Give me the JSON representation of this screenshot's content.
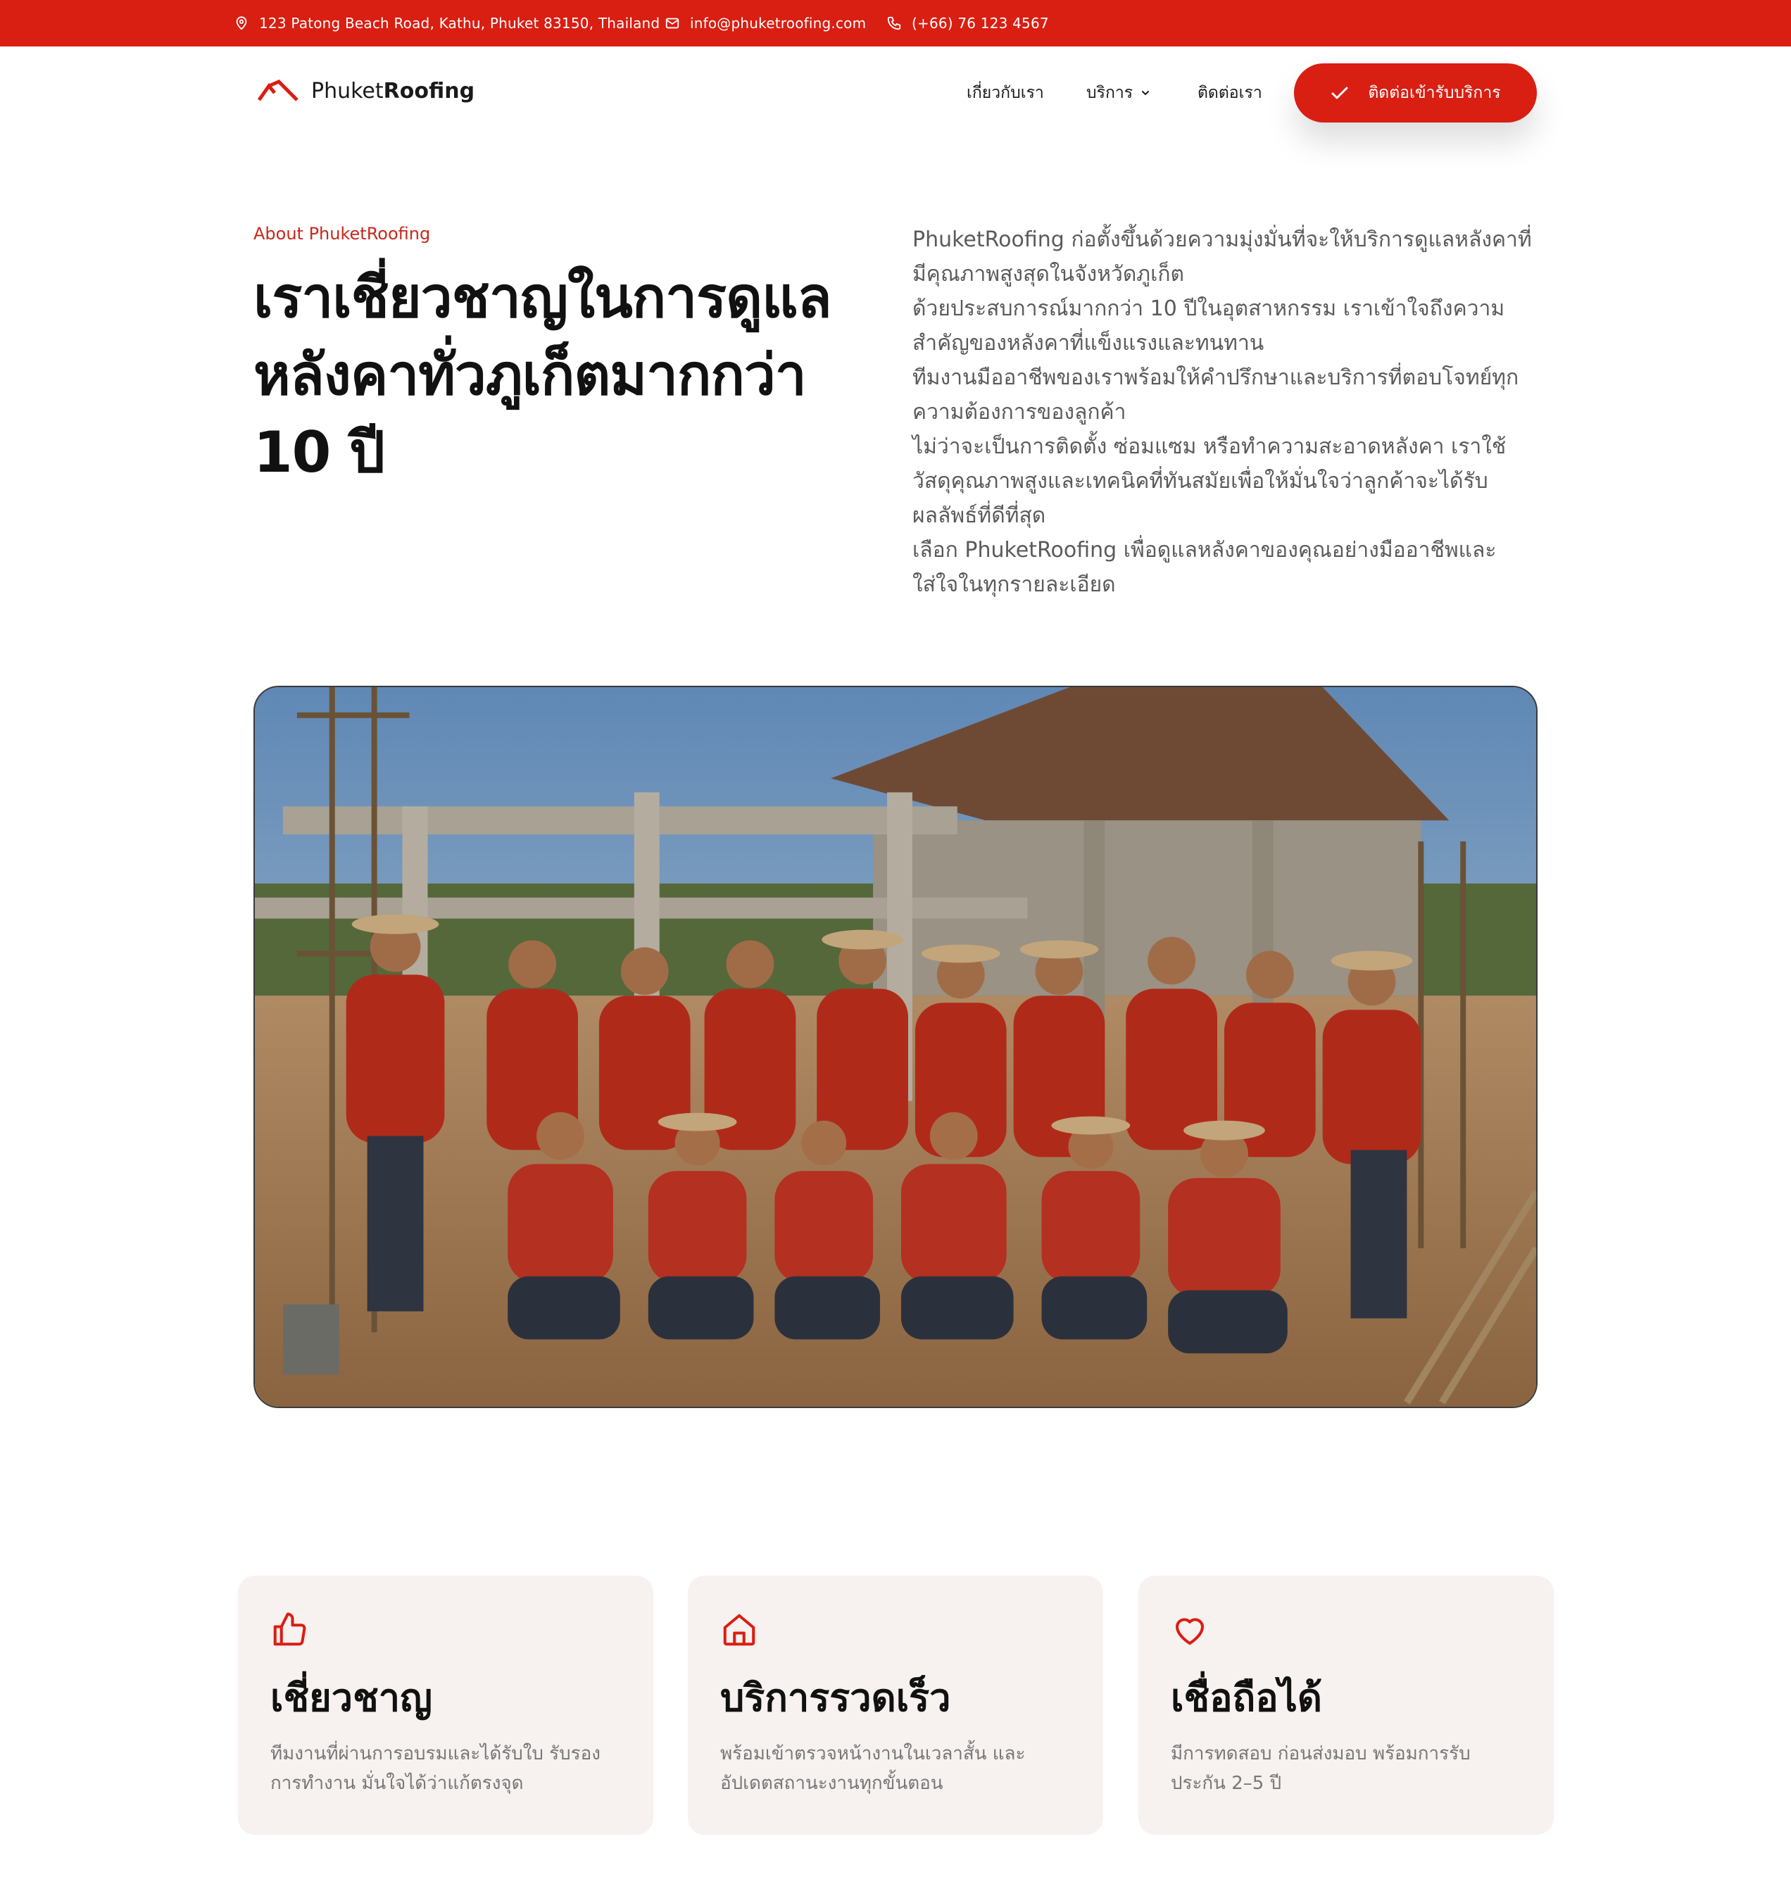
{
  "topbar": {
    "address": "123 Patong Beach Road, Kathu, Phuket 83150, Thailand",
    "email": "info@phuketroofing.com",
    "phone": "(+66) 76 123 4567",
    "address_icon": "map-pin-icon",
    "email_icon": "envelope-icon",
    "phone_icon": "phone-icon"
  },
  "header": {
    "brand_light": "Phuket",
    "brand_bold": "Roofing",
    "logo_icon": "roof-logo-icon",
    "nav": {
      "about": "เกี่ยวกับเรา",
      "services": "บริการ",
      "contact": "ติดต่อเรา"
    },
    "cta_label": "ติดต่อเข้ารับบริการ",
    "cta_icon": "check-icon"
  },
  "about": {
    "eyebrow": "About PhuketRoofing",
    "headline_lines": [
      "เราเชี่ยวชาญในการดูแล",
      "หลังคาทั่วภูเก็ตมากกว่า",
      "10 ปี"
    ],
    "paragraphs": [
      "PhuketRoofing ก่อตั้งขึ้นด้วยความมุ่งมั่นที่จะให้บริการดูแลหลังคาที่มีคุณภาพสูงสุดในจังหวัดภูเก็ต",
      "ด้วยประสบการณ์มากกว่า 10 ปีในอุตสาหกรรม เราเข้าใจถึงความสำคัญของหลังคาที่แข็งแรงและทนทาน",
      "ทีมงานมืออาชีพของเราพร้อมให้คำปรึกษาและบริการที่ตอบโจทย์ทุกความต้องการของลูกค้า",
      "ไม่ว่าจะเป็นการติดตั้ง ซ่อมแซม หรือทำความสะอาดหลังคา เราใช้วัสดุคุณภาพสูงและเทคนิคที่ทันสมัยเพื่อให้มั่นใจว่าลูกค้าจะได้รับผลลัพธ์ที่ดีที่สุด",
      "เลือก PhuketRoofing เพื่อดูแลหลังคาของคุณอย่างมืออาชีพและใส่ใจในทุกรายละเอียด"
    ]
  },
  "features": [
    {
      "icon": "thumbs-up-icon",
      "title": "เชี่ยวชาญ",
      "desc": "ทีมงานที่ผ่านการอบรมและได้รับใบ รับรองการทำงาน มั่นใจได้ว่าแก้ตรงจุด"
    },
    {
      "icon": "home-icon",
      "title": "บริการรวดเร็ว",
      "desc": "พร้อมเข้าตรวจหน้างานในเวลาสั้น และอัปเดตสถานะงานทุกขั้นตอน"
    },
    {
      "icon": "heart-icon",
      "title": "เชื่อถือได้",
      "desc": "มีการทดสอบ ก่อนส่งมอบ พร้อมการรับประกัน 2–5 ปี"
    }
  ],
  "colors": {
    "brand_red": "#d91e12",
    "card_bg": "#f7f1f0"
  }
}
